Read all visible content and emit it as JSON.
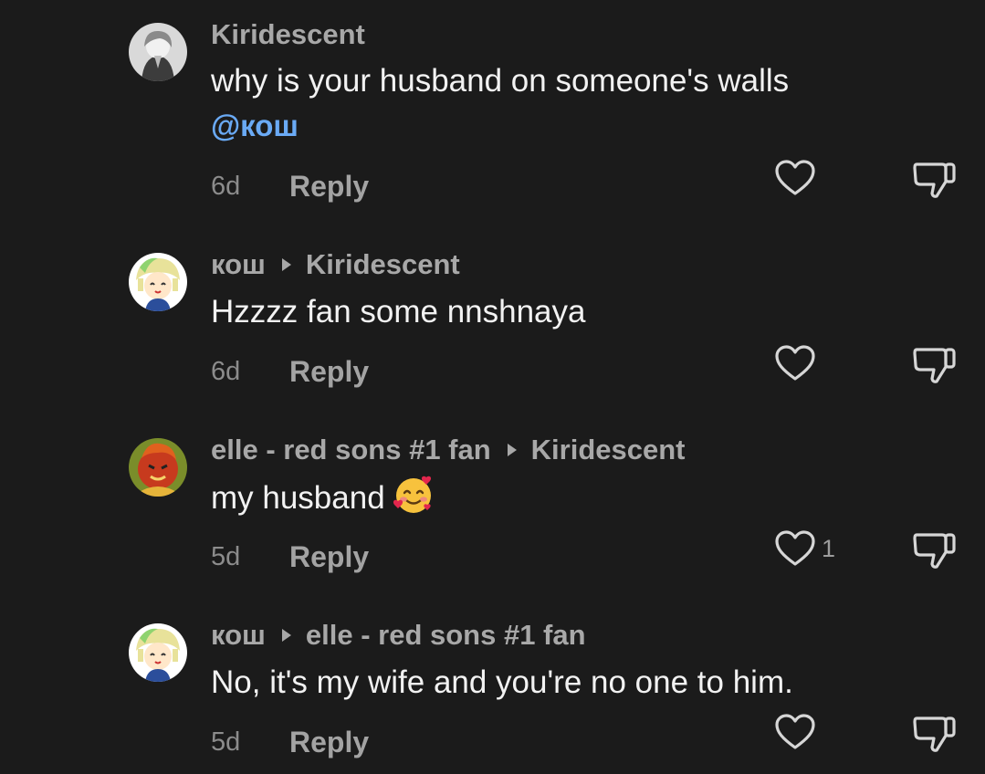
{
  "comments": [
    {
      "author": "Kiridescent",
      "reply_to": "",
      "text": "why is your husband on someone's walls",
      "mention": "@кош",
      "time": "6d",
      "reply_label": "Reply",
      "like_count": ""
    },
    {
      "author": "кош",
      "reply_to": "Kiridescent",
      "text": "Hzzzz fan some nnshnaya",
      "mention": "",
      "time": "6d",
      "reply_label": "Reply",
      "like_count": ""
    },
    {
      "author": "elle - red sons #1 fan",
      "reply_to": "Kiridescent",
      "text": "my husband",
      "emoji": "smiling-face-with-hearts",
      "mention": "",
      "time": "5d",
      "reply_label": "Reply",
      "like_count": "1"
    },
    {
      "author": "кош",
      "reply_to": "elle - red sons #1 fan",
      "text": "No, it's my wife and you're no one to him.",
      "mention": "",
      "time": "5d",
      "reply_label": "Reply",
      "like_count": ""
    }
  ],
  "icons": {
    "like": "heart-outline-icon",
    "dislike": "thumbs-down-outline-icon",
    "reply_to": "reply-arrow-icon"
  },
  "colors": {
    "background": "#1b1b1b",
    "text": "#f2f2f2",
    "secondary": "#a8a8a8",
    "mention": "#6aaaf5"
  }
}
